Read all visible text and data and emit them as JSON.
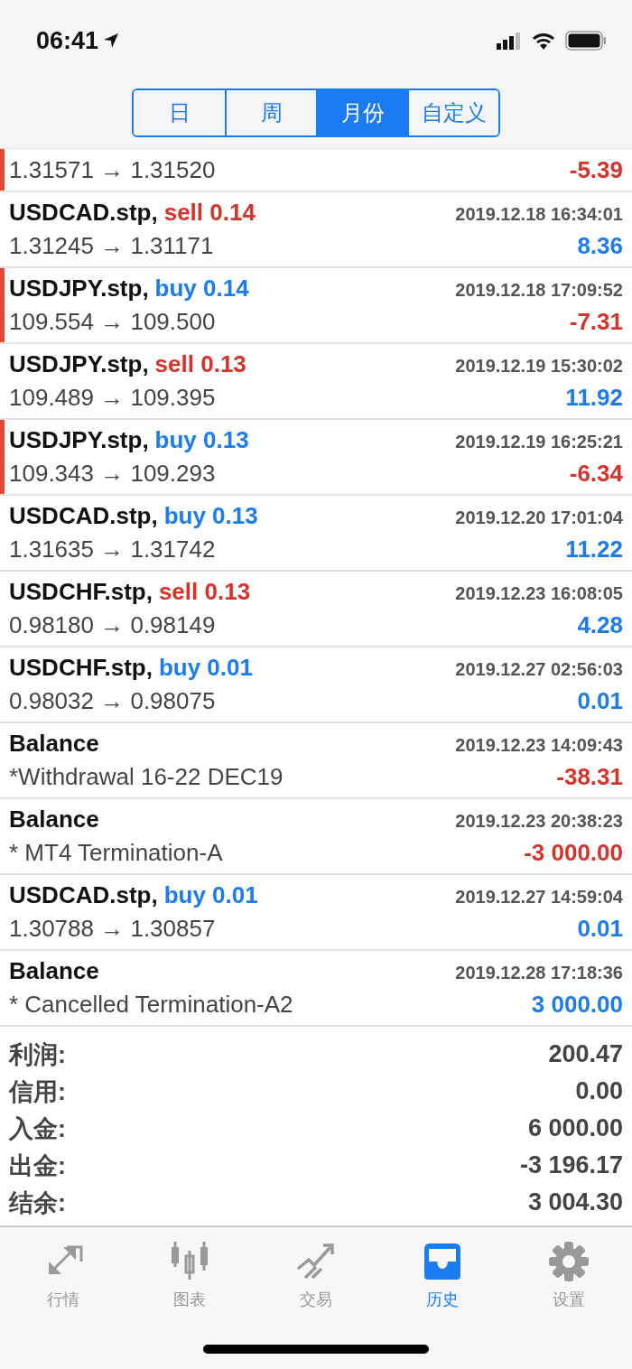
{
  "status_bar": {
    "time": "06:41"
  },
  "period_tabs": [
    {
      "label": "日",
      "selected": false
    },
    {
      "label": "周",
      "selected": false
    },
    {
      "label": "月份",
      "selected": true
    },
    {
      "label": "自定义",
      "selected": false
    }
  ],
  "history": [
    {
      "kind": "trade",
      "flagged": true,
      "prices": "1.31571 → 1.31520",
      "profit": "-5.39",
      "loss": true
    },
    {
      "kind": "trade",
      "flagged": false,
      "symbol": "USDCAD.stp,",
      "order": "sell 0.14",
      "sell": true,
      "time": "2019.12.18 16:34:01",
      "prices": "1.31245 → 1.31171",
      "profit": "8.36",
      "loss": false
    },
    {
      "kind": "trade",
      "flagged": true,
      "symbol": "USDJPY.stp,",
      "order": "buy 0.14",
      "sell": false,
      "time": "2019.12.18 17:09:52",
      "prices": "109.554 → 109.500",
      "profit": "-7.31",
      "loss": true
    },
    {
      "kind": "trade",
      "flagged": false,
      "symbol": "USDJPY.stp,",
      "order": "sell 0.13",
      "sell": true,
      "time": "2019.12.19 15:30:02",
      "prices": "109.489 → 109.395",
      "profit": "11.92",
      "loss": false
    },
    {
      "kind": "trade",
      "flagged": true,
      "symbol": "USDJPY.stp,",
      "order": "buy 0.13",
      "sell": false,
      "time": "2019.12.19 16:25:21",
      "prices": "109.343 → 109.293",
      "profit": "-6.34",
      "loss": true
    },
    {
      "kind": "trade",
      "flagged": false,
      "symbol": "USDCAD.stp,",
      "order": "buy 0.13",
      "sell": false,
      "time": "2019.12.20 17:01:04",
      "prices": "1.31635 → 1.31742",
      "profit": "11.22",
      "loss": false
    },
    {
      "kind": "trade",
      "flagged": false,
      "symbol": "USDCHF.stp,",
      "order": "sell 0.13",
      "sell": true,
      "time": "2019.12.23 16:08:05",
      "prices": "0.98180 → 0.98149",
      "profit": "4.28",
      "loss": false
    },
    {
      "kind": "trade",
      "flagged": false,
      "symbol": "USDCHF.stp,",
      "order": "buy 0.01",
      "sell": false,
      "time": "2019.12.27 02:56:03",
      "prices": "0.98032 → 0.98075",
      "profit": "0.01",
      "loss": false
    },
    {
      "kind": "balance",
      "flagged": false,
      "symbol": "Balance",
      "time": "2019.12.23 14:09:43",
      "comment": "*Withdrawal 16-22 DEC19",
      "profit": "-38.31",
      "loss": true
    },
    {
      "kind": "balance",
      "flagged": false,
      "symbol": "Balance",
      "time": "2019.12.23 20:38:23",
      "comment": "* MT4 Termination-A",
      "profit": "-3 000.00",
      "loss": true
    },
    {
      "kind": "trade",
      "flagged": false,
      "symbol": "USDCAD.stp,",
      "order": "buy 0.01",
      "sell": false,
      "time": "2019.12.27 14:59:04",
      "prices": "1.30788 → 1.30857",
      "profit": "0.01",
      "loss": false
    },
    {
      "kind": "balance",
      "flagged": false,
      "symbol": "Balance",
      "time": "2019.12.28 17:18:36",
      "comment": "* Cancelled Termination-A2",
      "profit": "3 000.00",
      "loss": false
    }
  ],
  "summary": [
    {
      "label": "利润:",
      "value": "200.47"
    },
    {
      "label": "信用:",
      "value": "0.00"
    },
    {
      "label": "入金:",
      "value": "6 000.00"
    },
    {
      "label": "出金:",
      "value": "-3 196.17"
    },
    {
      "label": "结余:",
      "value": "3 004.30"
    }
  ],
  "tab_bar": [
    {
      "label": "行情",
      "selected": false
    },
    {
      "label": "图表",
      "selected": false
    },
    {
      "label": "交易",
      "selected": false
    },
    {
      "label": "历史",
      "selected": true
    },
    {
      "label": "设置",
      "selected": false
    }
  ]
}
